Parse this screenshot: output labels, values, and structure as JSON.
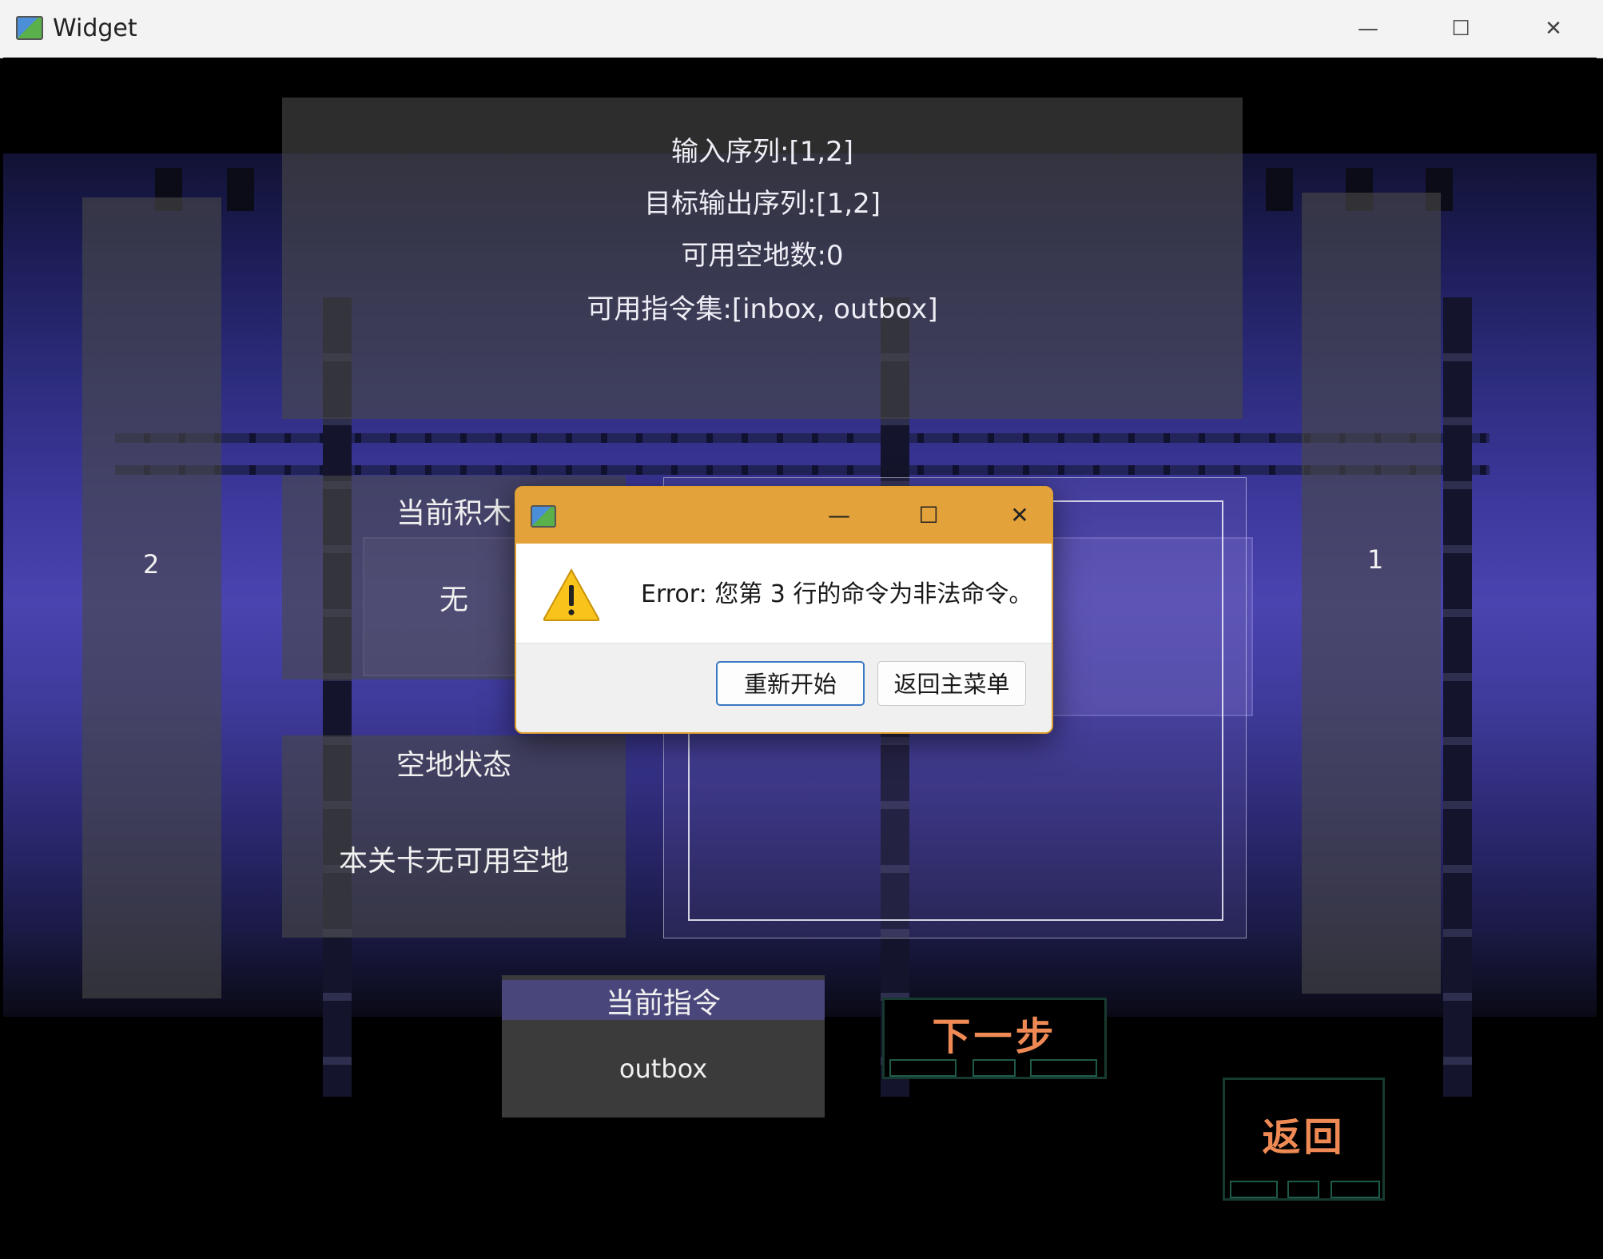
{
  "window": {
    "title": "Widget",
    "minimize_glyph": "—",
    "maximize_glyph": "☐",
    "close_glyph": "✕"
  },
  "level_info": {
    "input_sequence": "输入序列:[1,2]",
    "target_output": "目标输出序列:[1,2]",
    "free_space_count": "可用空地数:0",
    "instruction_set": "可用指令集:[inbox, outbox]"
  },
  "left_stack": {
    "count_label": "2"
  },
  "right_stack": {
    "count_label": "1"
  },
  "current_block": {
    "title": "当前积木",
    "value": "无"
  },
  "floor_status": {
    "title": "空地状态",
    "value": "本关卡无可用空地"
  },
  "current_instruction": {
    "title": "当前指令",
    "value": "outbox"
  },
  "controls": {
    "next_step_label": "下一步",
    "back_label": "返回"
  },
  "dialog": {
    "icon": "warning-icon",
    "message": "Error: 您第 3 行的命令为非法命令。",
    "restart_label": "重新开始",
    "main_menu_label": "返回主菜单"
  },
  "colors": {
    "dialog_titlebar": "#e3a23a",
    "pixel_button_text": "#f08a55",
    "pixel_button_border": "#173a30",
    "scene_purple": "#4a44b0"
  }
}
